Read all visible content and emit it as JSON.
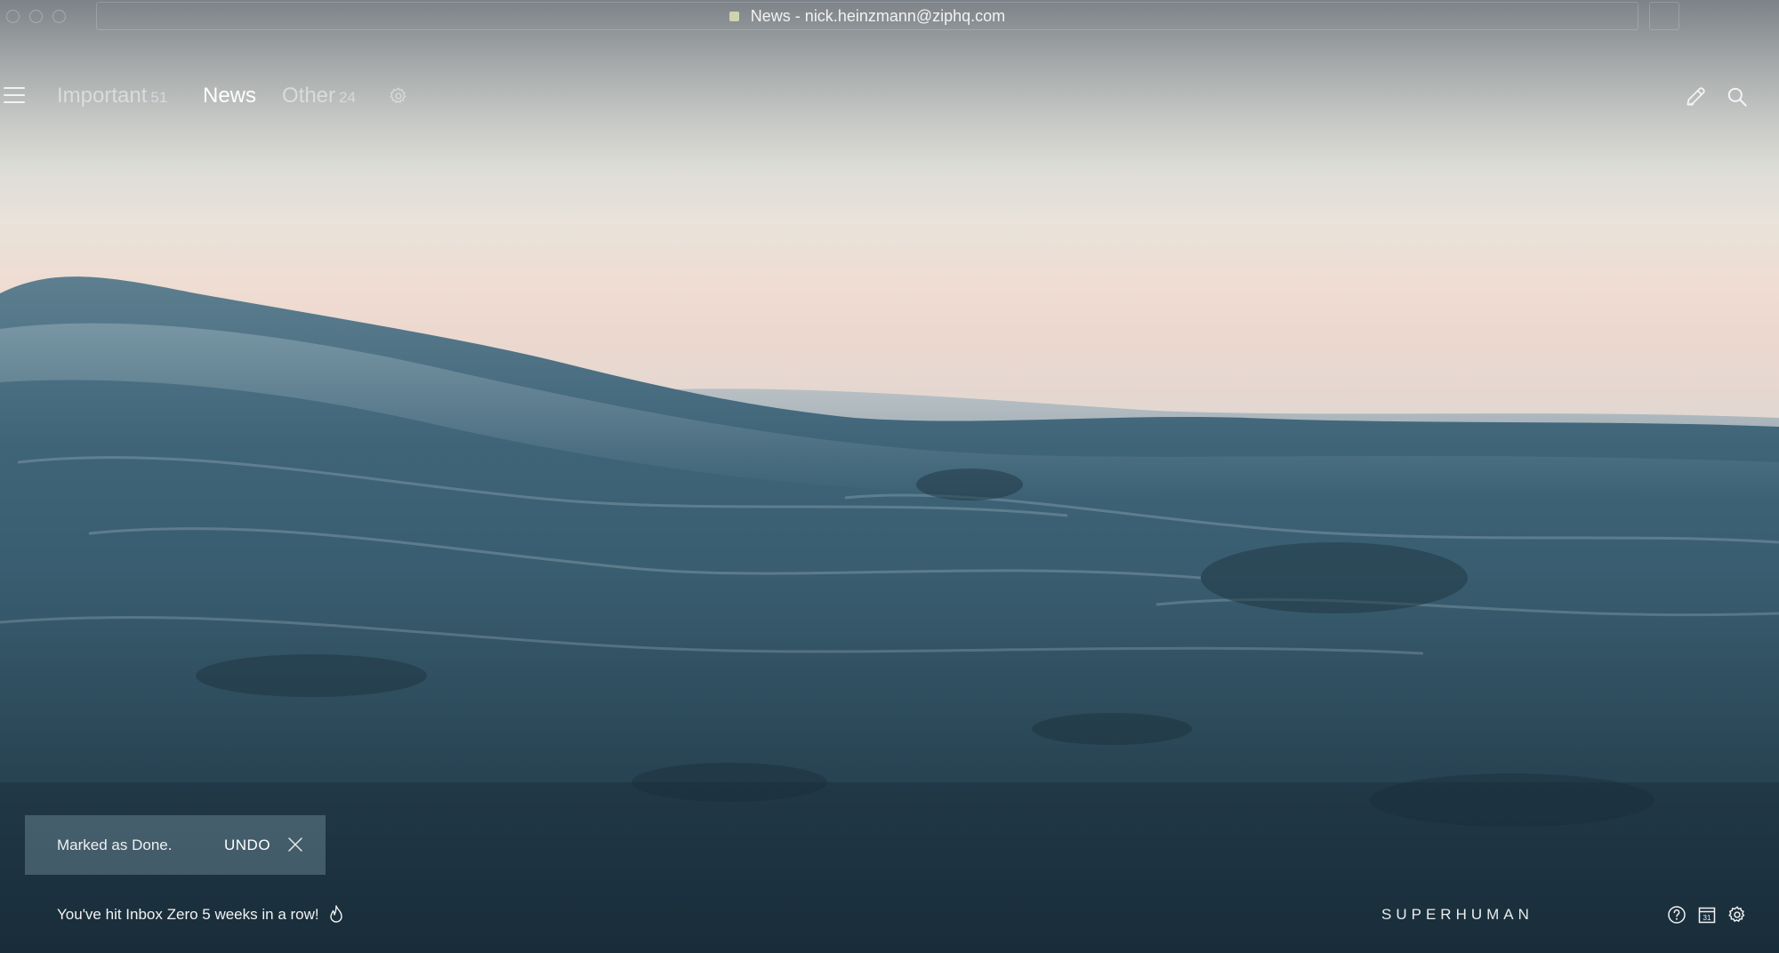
{
  "window": {
    "title": "News - nick.heinzmann@ziphq.com"
  },
  "nav": {
    "tabs": [
      {
        "label": "Important",
        "count": "51",
        "active": false
      },
      {
        "label": "News",
        "count": "",
        "active": true
      },
      {
        "label": "Other",
        "count": "24",
        "active": false
      }
    ],
    "icons": [
      "hamburger-menu-icon",
      "gear-icon",
      "compose-icon",
      "search-icon"
    ]
  },
  "toast": {
    "message": "Marked as Done.",
    "undo_label": "UNDO"
  },
  "footer": {
    "inbox_zero_text": "You've hit Inbox Zero 5 weeks in a row!",
    "brand": "SUPERHUMAN",
    "icons": [
      "help-icon",
      "calendar-icon",
      "settings-icon"
    ],
    "calendar_day": "31"
  },
  "colors": {
    "sea_dark": "#1f3a4a",
    "sea_mid": "#3f6275",
    "sky_top": "#7c8287",
    "horizon": "#efdcd2"
  }
}
